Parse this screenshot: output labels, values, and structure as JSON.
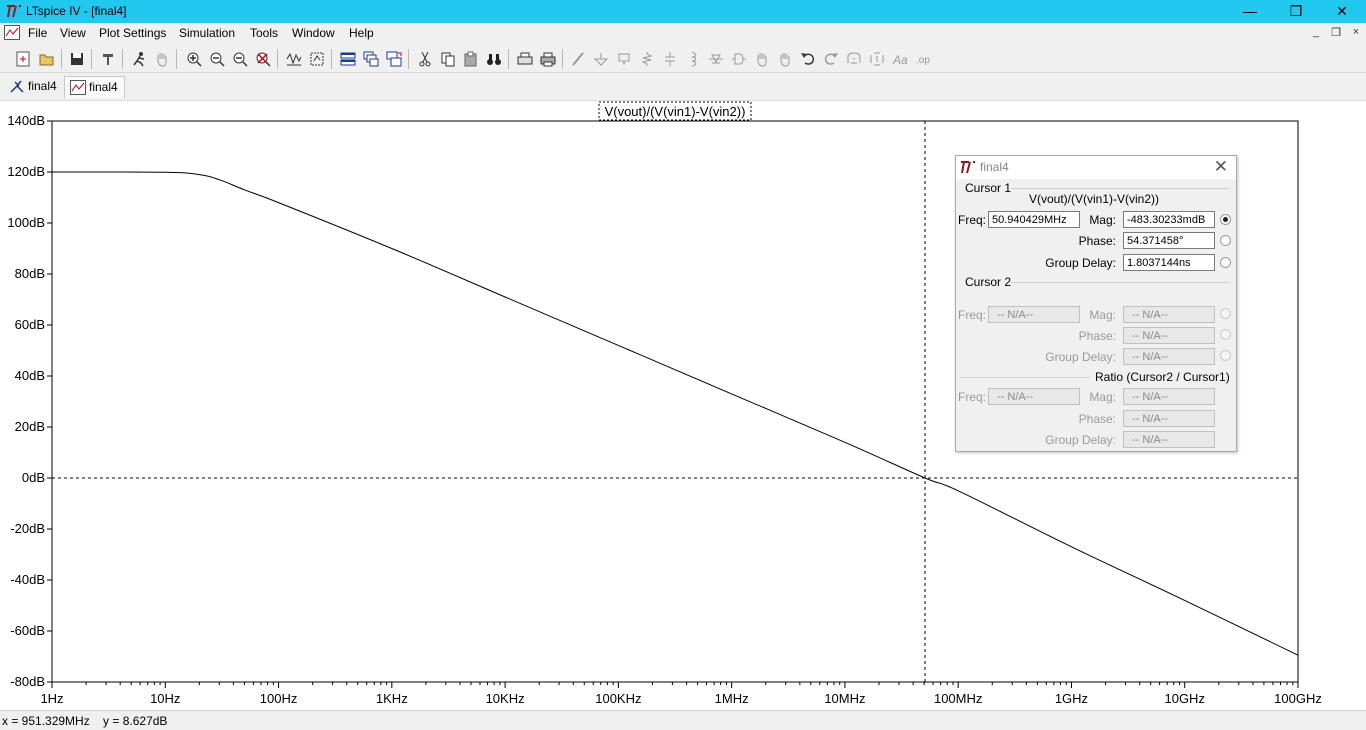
{
  "window": {
    "title": "LTspice IV - [final4]",
    "minimize": "—",
    "maximize": "❐",
    "close": "✕"
  },
  "menu": [
    "File",
    "View",
    "Plot Settings",
    "Simulation",
    "Tools",
    "Window",
    "Help"
  ],
  "mdi_controls": [
    "_",
    "❐",
    "×"
  ],
  "toolbar_icons": [
    "new-schematic-icon",
    "open-icon",
    "save-icon",
    "control-panel-icon",
    "run-icon",
    "pan-hand-icon",
    "zoom-in-icon",
    "zoom-out-icon",
    "zoom-fit-icon",
    "zoom-cancel-icon",
    "autorange-icon",
    "mark-icon",
    "tile-horizontal-icon",
    "cascade-icon",
    "tile-icon",
    "cut-icon",
    "copy-icon",
    "paste-icon",
    "find-icon",
    "print-preview-icon",
    "print-icon",
    "wire-icon",
    "ground-icon",
    "label-icon",
    "resistor-icon",
    "capacitor-icon",
    "inductor-icon",
    "diode-icon",
    "component-icon",
    "move-icon",
    "drag-icon",
    "undo-icon",
    "redo-icon",
    "rotate-icon",
    "mirror-icon",
    "text-icon",
    "spice-directive-icon"
  ],
  "tabs": [
    {
      "label": "final4",
      "icon": "schematic-icon",
      "active": false
    },
    {
      "label": "final4",
      "icon": "waveform-icon",
      "active": true
    }
  ],
  "plot": {
    "trace_title": "V(vout)/(V(vin1)-V(vin2))",
    "trace_color": "#000000",
    "cursor_style": "dashed"
  },
  "chart_data": {
    "type": "line",
    "title": "V(vout)/(V(vin1)-V(vin2))",
    "xlabel": "",
    "ylabel": "",
    "x_scale": "log",
    "x_ticks": [
      "1Hz",
      "10Hz",
      "100Hz",
      "1KHz",
      "10KHz",
      "100KHz",
      "1MHz",
      "10MHz",
      "100MHz",
      "1GHz",
      "10GHz",
      "100GHz"
    ],
    "y_ticks": [
      "140dB",
      "120dB",
      "100dB",
      "80dB",
      "60dB",
      "40dB",
      "20dB",
      "0dB",
      "-20dB",
      "-40dB",
      "-60dB",
      "-80dB"
    ],
    "xlim": [
      1,
      100000000000
    ],
    "ylim": [
      -80,
      140
    ],
    "grid": false,
    "series": [
      {
        "points": [
          [
            1,
            120
          ],
          [
            10,
            119.9
          ],
          [
            20,
            119
          ],
          [
            30,
            117
          ],
          [
            50,
            113
          ],
          [
            100,
            108
          ],
          [
            1000,
            90
          ],
          [
            10000,
            71
          ],
          [
            100000,
            52
          ],
          [
            1000000,
            33
          ],
          [
            10000000,
            14
          ],
          [
            50940429,
            0
          ],
          [
            100000000,
            -5
          ],
          [
            1000000000,
            -27
          ],
          [
            10000000000,
            -48
          ],
          [
            100000000000,
            -69.5
          ]
        ]
      }
    ],
    "cursor": {
      "x": 50940429,
      "y": 0
    }
  },
  "cursor_dialog": {
    "title": "final4",
    "cursor1": {
      "label": "Cursor 1",
      "expression": "V(vout)/(V(vin1)-V(vin2))",
      "freq_label": "Freq:",
      "freq": "50.940429MHz",
      "mag_label": "Mag:",
      "mag": "-483.30233mdB",
      "phase_label": "Phase:",
      "phase": "54.371458°",
      "gd_label": "Group Delay:",
      "gd": "1.8037144ns"
    },
    "cursor2": {
      "label": "Cursor 2",
      "freq_label": "Freq:",
      "freq": "-- N/A--",
      "mag_label": "Mag:",
      "mag": "-- N/A--",
      "phase_label": "Phase:",
      "phase": "-- N/A--",
      "gd_label": "Group Delay:",
      "gd": "-- N/A--"
    },
    "ratio": {
      "label": "Ratio (Cursor2 / Cursor1)",
      "freq_label": "Freq:",
      "freq": "-- N/A--",
      "mag_label": "Mag:",
      "mag": "-- N/A--",
      "phase_label": "Phase:",
      "phase": "-- N/A--",
      "gd_label": "Group Delay:",
      "gd": "-- N/A--"
    }
  },
  "status": {
    "text": "x = 951.329MHz    y = 8.627dB"
  }
}
